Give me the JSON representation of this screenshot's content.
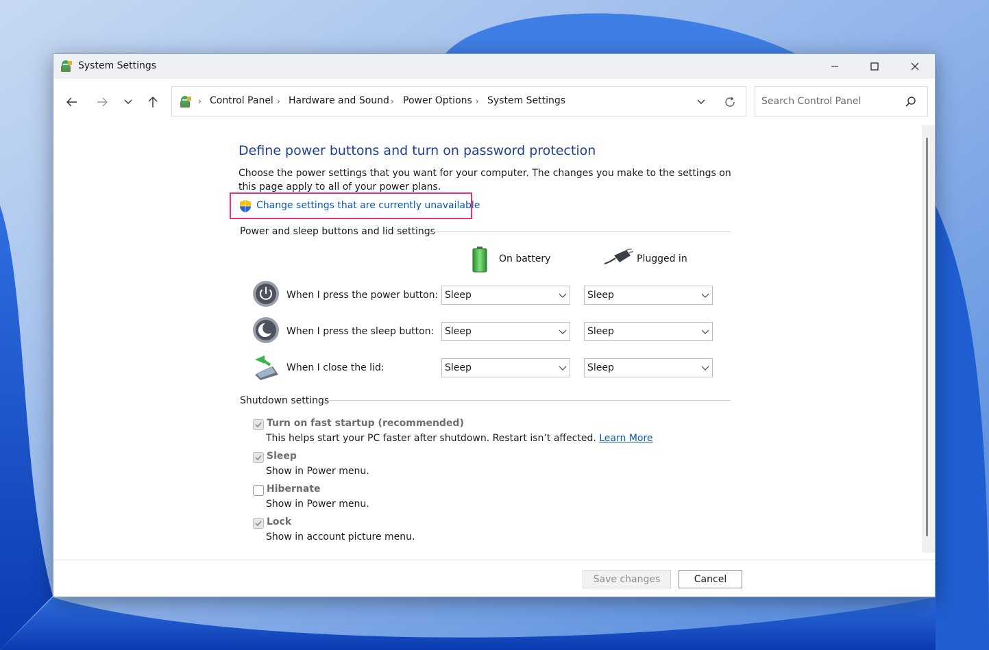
{
  "window": {
    "title": "System Settings",
    "app_icon": "control-panel-icon"
  },
  "nav": {
    "back_icon": "back-arrow-icon",
    "forward_icon": "forward-arrow-icon",
    "recent_icon": "chevron-down-icon",
    "up_icon": "up-arrow-icon"
  },
  "address": {
    "breadcrumbs": [
      "Control Panel",
      "Hardware and Sound",
      "Power Options",
      "System Settings"
    ]
  },
  "search": {
    "placeholder": "Search Control Panel",
    "value": ""
  },
  "content": {
    "heading": "Define power buttons and turn on password protection",
    "description": "Choose the power settings that you want for your computer. The changes you make to the settings on this page apply to all of your power plans.",
    "change_link": "Change settings that are currently unavailable",
    "power_group": {
      "title": "Power and sleep buttons and lid settings",
      "columns": [
        "On battery",
        "Plugged in"
      ],
      "rows": [
        {
          "label": "When I press the power button:",
          "icon": "power-button-icon",
          "on_battery": "Sleep",
          "plugged_in": "Sleep"
        },
        {
          "label": "When I press the sleep button:",
          "icon": "sleep-button-icon",
          "on_battery": "Sleep",
          "plugged_in": "Sleep"
        },
        {
          "label": "When I close the lid:",
          "icon": "laptop-lid-icon",
          "on_battery": "Sleep",
          "plugged_in": "Sleep"
        }
      ]
    },
    "shutdown_group": {
      "title": "Shutdown settings",
      "items": [
        {
          "title": "Turn on fast startup (recommended)",
          "desc": "This helps start your PC faster after shutdown. Restart isn’t affected.",
          "link": "Learn More",
          "checked": true
        },
        {
          "title": "Sleep",
          "desc": "Show in Power menu.",
          "checked": true
        },
        {
          "title": "Hibernate",
          "desc": "Show in Power menu.",
          "checked": false
        },
        {
          "title": "Lock",
          "desc": "Show in account picture menu.",
          "checked": true
        }
      ]
    }
  },
  "footer": {
    "save_label": "Save changes",
    "cancel_label": "Cancel"
  },
  "colors": {
    "heading": "#1e3f95",
    "link": "#0b57b4",
    "highlight": "#e8317a"
  }
}
